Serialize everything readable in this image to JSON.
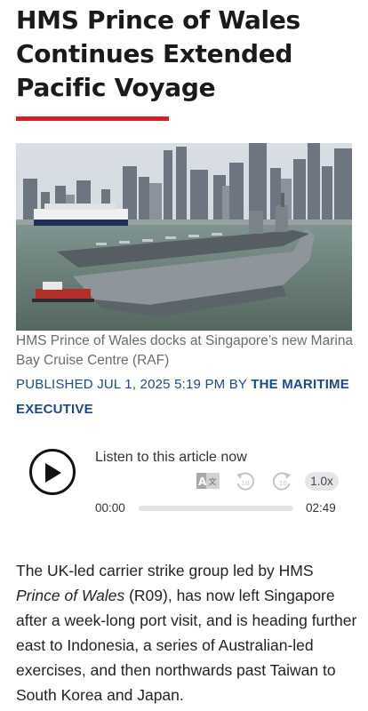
{
  "article": {
    "title": "HMS Prince of Wales Continues Extended Pacific Voyage",
    "image_caption": "HMS Prince of Wales docks at Singapore’s new Marina Bay Cruise Centre (RAF)",
    "byline": {
      "published": "PUBLISHED JUL 1, 2025 5:19 PM BY ",
      "author": "THE MARITIME EXECUTIVE"
    },
    "body": {
      "part1": "The UK-led carrier strike group led by HMS ",
      "ship_name": "Prince of Wales",
      "part2": " (R09), has now left Singapore after a week-long port visit, and is heading further east to Indonesia, a series of Australian-led exercises, and then northwards past Taiwan to South Korea and Japan."
    }
  },
  "player": {
    "label": "Listen to this article now",
    "current_time": "00:00",
    "duration": "02:49",
    "speed": "1.0x",
    "progress": 0,
    "rewind_seconds": "10",
    "forward_seconds": "10",
    "icons": {
      "play": "play-icon",
      "translate": "translate-icon",
      "rewind": "rewind-10-icon",
      "forward": "forward-10-icon"
    }
  },
  "colors": {
    "accent_rule": "#d81f26",
    "byline": "#1a4a8f"
  }
}
